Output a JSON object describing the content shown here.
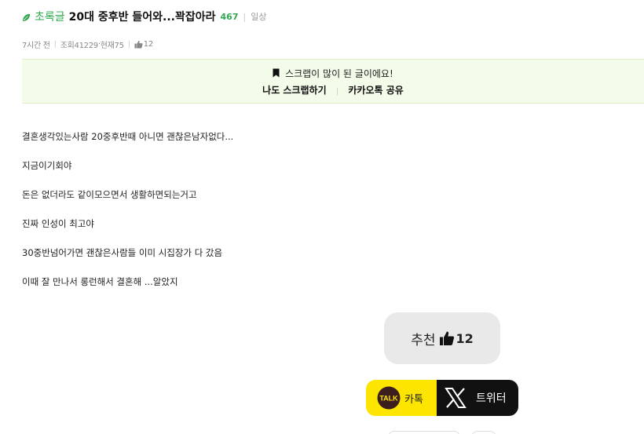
{
  "post": {
    "category": "초록글",
    "title": "20대 중후반 들어와...꽉잡아라",
    "comment_count": "467",
    "board": "일상"
  },
  "meta": {
    "time": "7시간 전",
    "views": "조회41229",
    "current": "현재75",
    "likes": "12"
  },
  "scrap": {
    "notice": "스크랩이 많이 된 글이에요!",
    "scrap_label": "나도 스크랩하기",
    "kakao_share_label": "카카오톡 공유"
  },
  "content": {
    "lines": [
      "결혼생각있는사람 20중후반때 아니면 괜찮은남자없다...",
      "지금이기회야",
      "돈은 없더라도 같이모으면서 생활하면되는거고",
      "진짜 인성이 최고야",
      "30중반넘어가면 괜찮은사람들 이미 시집장가 다 갔음",
      "이때 잘 만나서 롱런해서 결혼해 ...알았지"
    ]
  },
  "recommend": {
    "label": "추천",
    "count": "12"
  },
  "share": {
    "kakao_label": "카톡",
    "kakao_icon_text": "TALK",
    "twitter_label": "트위터"
  },
  "colors": {
    "accent_green": "#2fa84f",
    "scrap_bg": "#f3fbe9",
    "kakao_yellow": "#fee500",
    "x_black": "#111111"
  },
  "icons": [
    "leaf-icon",
    "thumbs-up-icon",
    "bookmark-icon",
    "kakao-talk-icon",
    "x-logo-icon"
  ]
}
